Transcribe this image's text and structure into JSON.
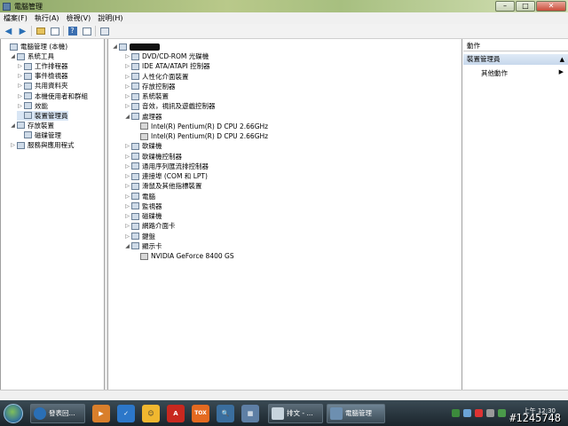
{
  "window": {
    "title": "電腦管理"
  },
  "menu": [
    "檔案(F)",
    "執行(A)",
    "檢視(V)",
    "說明(H)"
  ],
  "left_tree": [
    {
      "label": "電腦管理 (本機)",
      "level": 0,
      "exp": ""
    },
    {
      "label": "系統工具",
      "level": 1,
      "exp": "◢"
    },
    {
      "label": "工作排程器",
      "level": 2,
      "exp": "▷"
    },
    {
      "label": "事件檢視器",
      "level": 2,
      "exp": "▷"
    },
    {
      "label": "共用資料夾",
      "level": 2,
      "exp": "▷"
    },
    {
      "label": "本機使用者和群組",
      "level": 2,
      "exp": "▷"
    },
    {
      "label": "效能",
      "level": 2,
      "exp": "▷"
    },
    {
      "label": "裝置管理員",
      "level": 2,
      "exp": "",
      "selected": true
    },
    {
      "label": "存放裝置",
      "level": 1,
      "exp": "◢"
    },
    {
      "label": "磁碟管理",
      "level": 2,
      "exp": ""
    },
    {
      "label": "服務與應用程式",
      "level": 1,
      "exp": "▷"
    }
  ],
  "device_tree": [
    {
      "label": "DVD/CD-ROM 光碟機",
      "level": 1,
      "exp": "▷"
    },
    {
      "label": "IDE ATA/ATAPI 控制器",
      "level": 1,
      "exp": "▷"
    },
    {
      "label": "人性化介面裝置",
      "level": 1,
      "exp": "▷"
    },
    {
      "label": "存放控制器",
      "level": 1,
      "exp": "▷"
    },
    {
      "label": "系統裝置",
      "level": 1,
      "exp": "▷"
    },
    {
      "label": "音效，視訊及遊戲控制器",
      "level": 1,
      "exp": "▷"
    },
    {
      "label": "處理器",
      "level": 1,
      "exp": "◢"
    },
    {
      "label": "Intel(R) Pentium(R) D  CPU 2.66GHz",
      "level": 2,
      "exp": ""
    },
    {
      "label": "Intel(R) Pentium(R) D  CPU 2.66GHz",
      "level": 2,
      "exp": ""
    },
    {
      "label": "軟碟機",
      "level": 1,
      "exp": "▷"
    },
    {
      "label": "軟碟機控制器",
      "level": 1,
      "exp": "▷"
    },
    {
      "label": "通用序列匯流排控制器",
      "level": 1,
      "exp": "▷"
    },
    {
      "label": "連接埠 (COM 和 LPT)",
      "level": 1,
      "exp": "▷"
    },
    {
      "label": "滑鼠及其他指標裝置",
      "level": 1,
      "exp": "▷"
    },
    {
      "label": "電腦",
      "level": 1,
      "exp": "▷"
    },
    {
      "label": "監視器",
      "level": 1,
      "exp": "▷"
    },
    {
      "label": "磁碟機",
      "level": 1,
      "exp": "▷"
    },
    {
      "label": "網路介面卡",
      "level": 1,
      "exp": "▷"
    },
    {
      "label": "鍵盤",
      "level": 1,
      "exp": "▷"
    },
    {
      "label": "顯示卡",
      "level": 1,
      "exp": "◢"
    },
    {
      "label": "NVIDIA GeForce 8400 GS",
      "level": 2,
      "exp": ""
    }
  ],
  "actions": {
    "header": "動作",
    "section": "裝置管理員",
    "item": "其他動作"
  },
  "taskbar": {
    "items": [
      {
        "label": "發表回...",
        "color": "#2a6fb5"
      },
      {
        "label": "排文 - ...",
        "color": "#c7d4dd"
      },
      {
        "label": "電腦管理",
        "color": "#6d8fb0"
      }
    ],
    "clock": "上午 12:30",
    "watermark": "#1245748"
  },
  "colors": {
    "selection": "#d9e6f5",
    "taskbar": "#1b252c",
    "action_section": "#c7d8ec"
  }
}
